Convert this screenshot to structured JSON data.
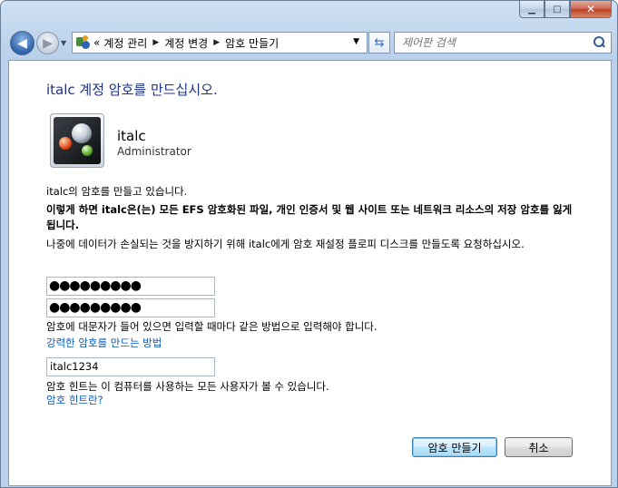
{
  "window": {
    "caption": {
      "minimize": "▁",
      "maximize": "□",
      "close": "✕"
    }
  },
  "nav": {
    "back_icon": "back-arrow-icon",
    "forward_icon": "forward-arrow-icon",
    "breadcrumb_prefix": "«",
    "breadcrumb": [
      "계정 관리",
      "계정 변경",
      "암호 만들기"
    ],
    "search_placeholder": "제어판 검색"
  },
  "main": {
    "title": "italc 계정 암호를 만드십시오.",
    "user": {
      "name": "italc",
      "role": "Administrator"
    },
    "info_line": "italc의 암호를 만들고 있습니다.",
    "warning": "이렇게 하면 italc은(는) 모든 EFS 암호화된 파일, 개인 인증서 및 웹 사이트 또는 네트워크 리소스의 저장 암호를 잃게 됩니다.",
    "advice": "나중에 데이터가 손실되는 것을 방지하기 위해 italc에게 암호 재설정 플로피 디스크를 만들도록 요청하십시오.",
    "password_mask": "●●●●●●●●●",
    "confirm_mask": "●●●●●●●●●",
    "case_note": "암호에 대문자가 들어 있으면 입력할 때마다 같은 방법으로 입력해야 합니다.",
    "strong_link": "강력한 암호를 만드는 방법",
    "hint_value": "italc1234",
    "hint_note": "암호 힌트는 이 컴퓨터를 사용하는 모든 사용자가 볼 수 있습니다.",
    "hint_link": "암호 힌트란?",
    "create_button": "암호 만들기",
    "cancel_button": "취소"
  }
}
